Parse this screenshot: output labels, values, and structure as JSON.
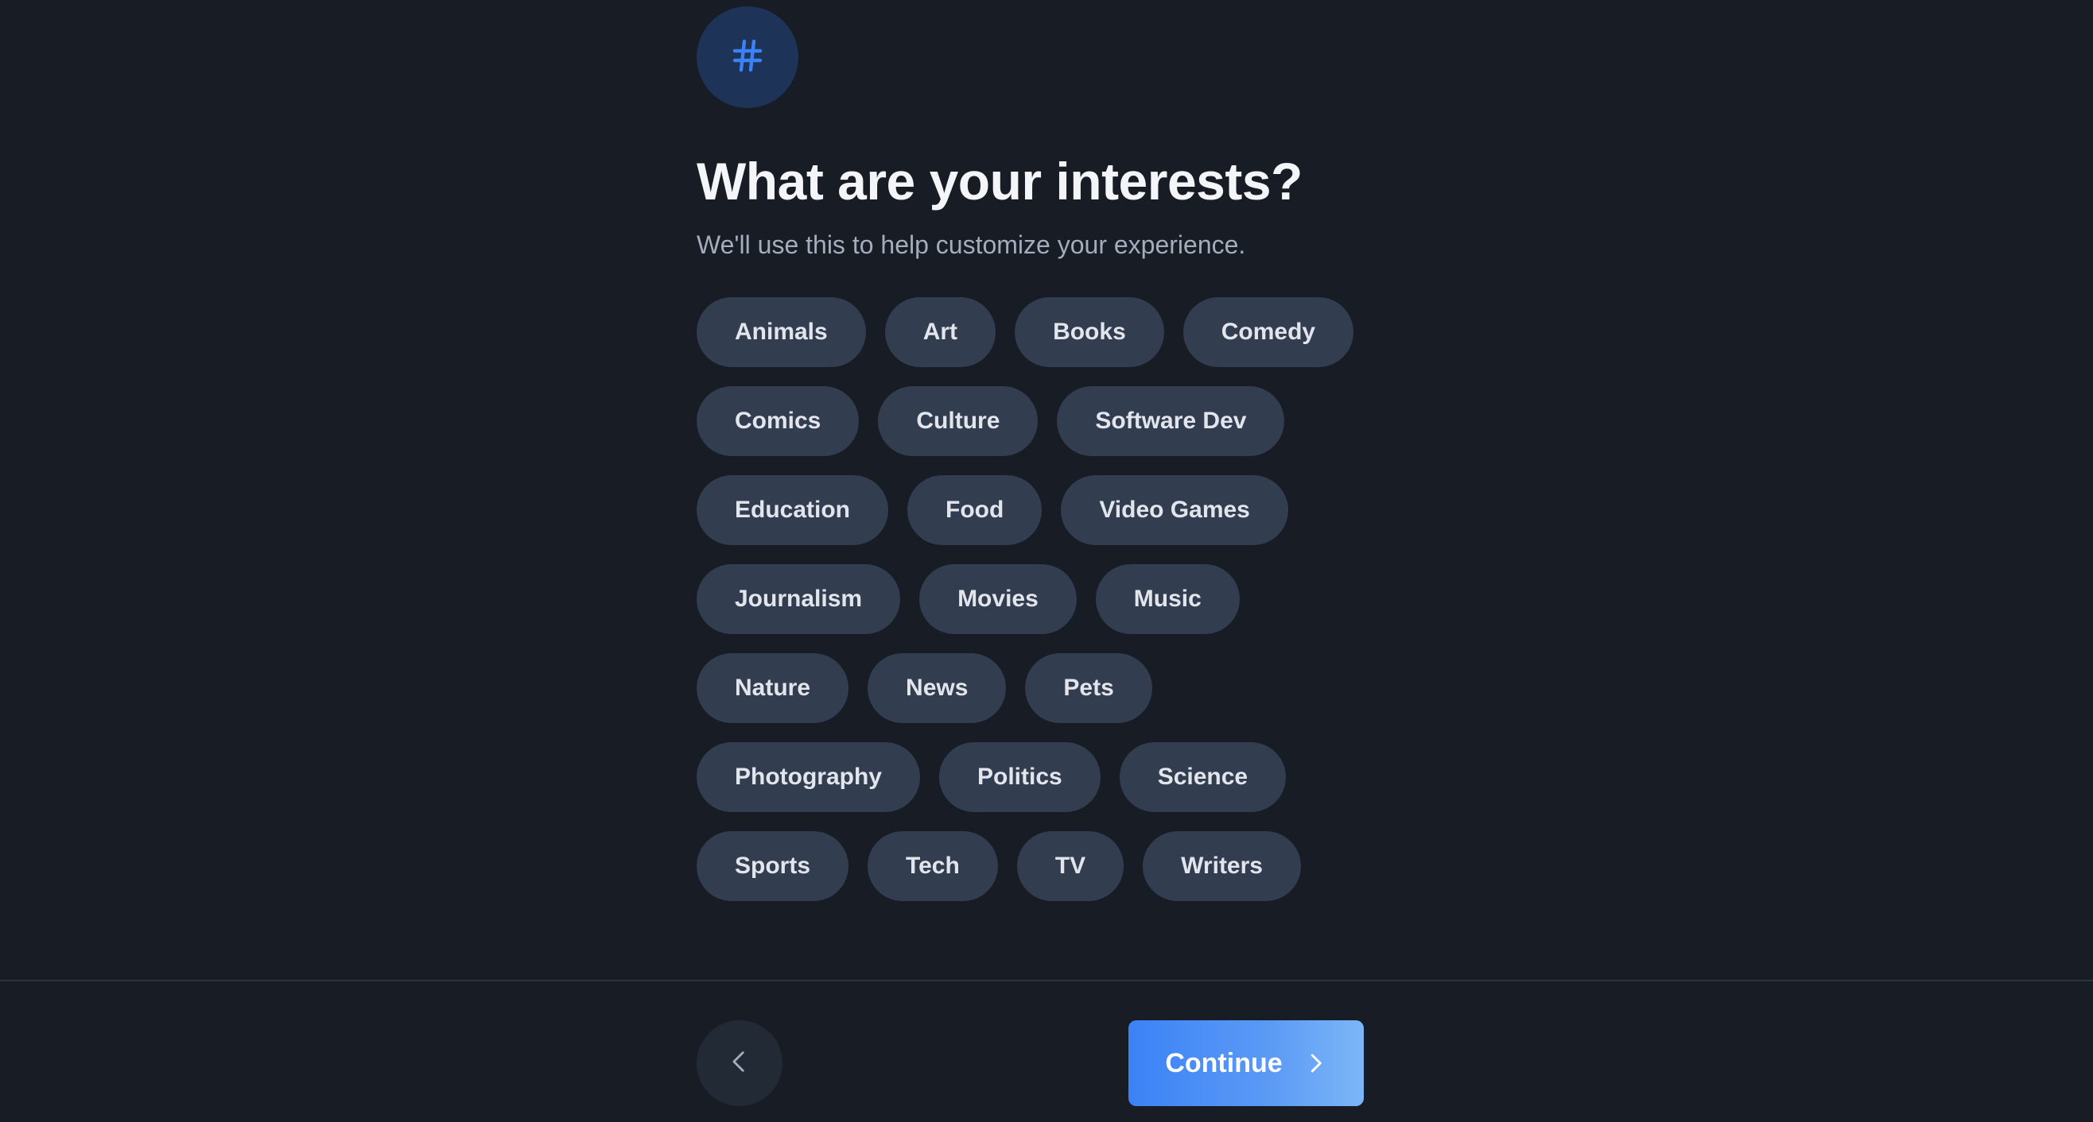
{
  "header": {
    "icon": "hashtag-icon",
    "title": "What are your interests?",
    "subtitle": "We'll use this to help customize your experience."
  },
  "interests": {
    "rows": [
      [
        "Animals",
        "Art",
        "Books",
        "Comedy"
      ],
      [
        "Comics",
        "Culture",
        "Software Dev"
      ],
      [
        "Education",
        "Food",
        "Video Games"
      ],
      [
        "Journalism",
        "Movies",
        "Music"
      ],
      [
        "Nature",
        "News",
        "Pets"
      ],
      [
        "Photography",
        "Politics",
        "Science"
      ],
      [
        "Sports",
        "Tech",
        "TV",
        "Writers"
      ]
    ]
  },
  "footer": {
    "back_icon": "chevron-left-icon",
    "continue_label": "Continue",
    "continue_icon": "chevron-right-icon"
  },
  "colors": {
    "background": "#171c25",
    "chip": "#323d4f",
    "accent": "#3b82f6",
    "icon_circle": "#1d3357"
  }
}
